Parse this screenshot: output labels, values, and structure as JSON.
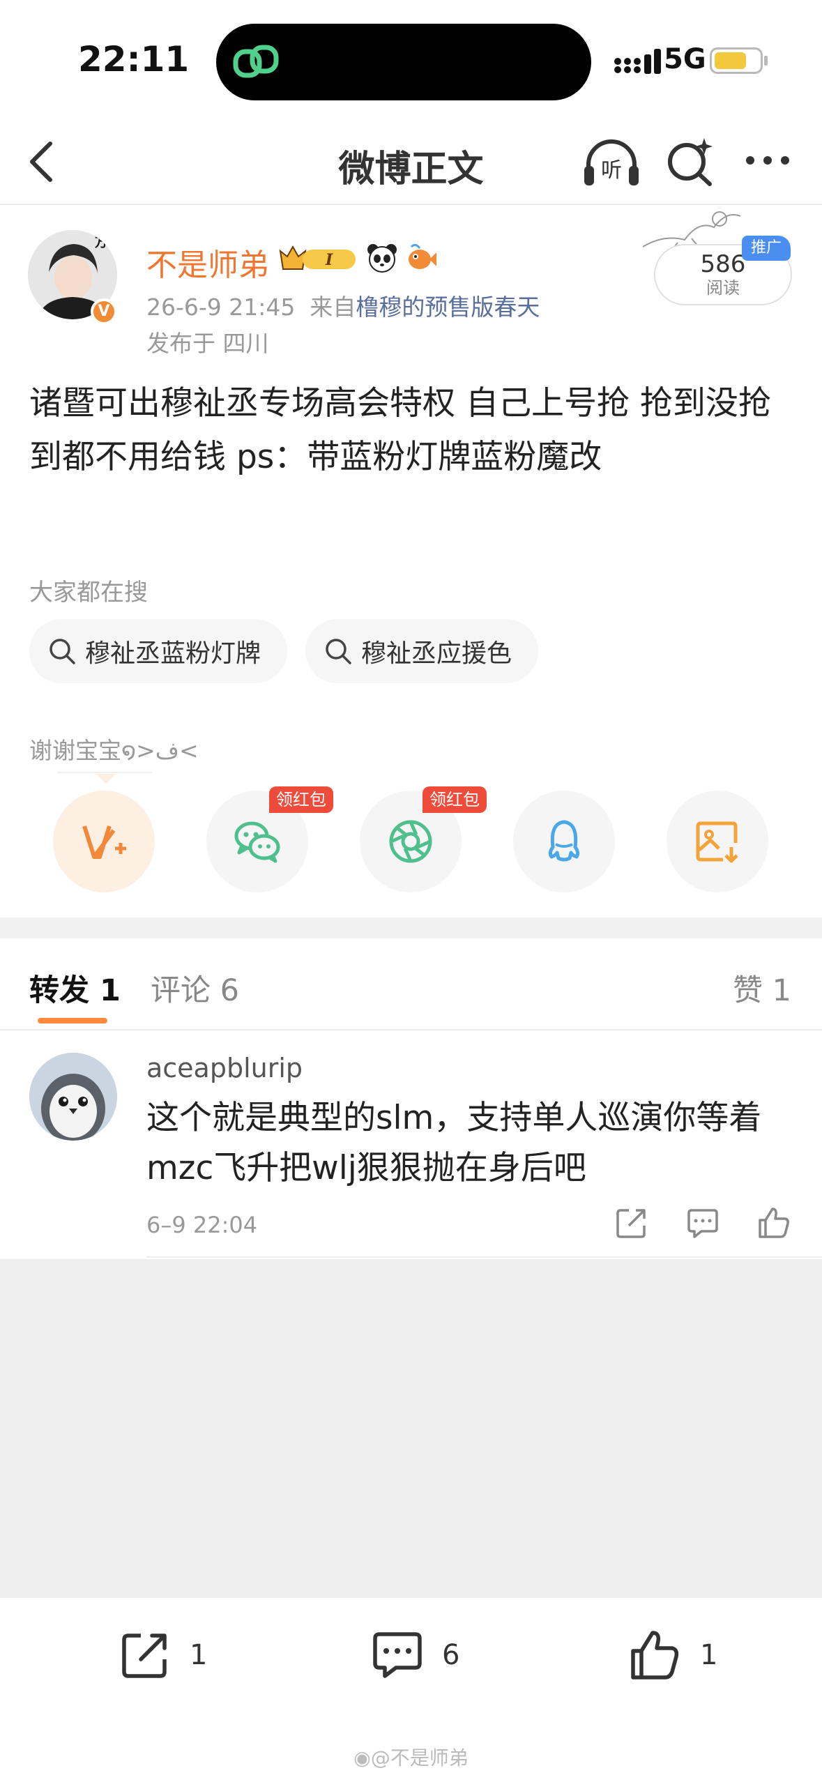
{
  "status": {
    "time": "22:11",
    "network": "5G"
  },
  "nav": {
    "title": "微博正文",
    "listen_label": "听"
  },
  "post": {
    "author": "不是师弟",
    "vip_badge": "I",
    "datetime": "26-6-9 21:45",
    "source_prefix": "来自",
    "source": "橹穆的预售版春天",
    "location": "发布于 四川",
    "text": "诸暨可出穆祉丞专场高会特权  自己上号抢  抢到没抢到都不用给钱  ps：带蓝粉灯牌蓝粉魔改",
    "reads_count": "586",
    "reads_label": "阅读",
    "promo_label": "推广",
    "avatar_caption": "万一"
  },
  "search": {
    "title": "大家都在搜",
    "chips": [
      "穆祉丞蓝粉灯牌",
      "穆祉丞应援色"
    ]
  },
  "thanks": "谢谢宝宝໑>ف<",
  "share": {
    "items": [
      {
        "name": "vip-share",
        "icon": "v-plus-icon"
      },
      {
        "name": "wechat",
        "icon": "wechat-icon",
        "tag": "领红包"
      },
      {
        "name": "moments",
        "icon": "moments-icon",
        "tag": "领红包"
      },
      {
        "name": "qq",
        "icon": "qq-icon"
      },
      {
        "name": "save-image",
        "icon": "save-image-icon"
      }
    ]
  },
  "tabs": {
    "repost": "转发 1",
    "comment": "评论 6",
    "like": "赞 1"
  },
  "comment": {
    "user": "aceapblurip",
    "text": "这个就是典型的slm，支持单人巡演你等着mzc飞升把wlj狠狠抛在身后吧",
    "time": "6–9 22:04"
  },
  "bottom": {
    "repost_count": "1",
    "comment_count": "6",
    "like_count": "1",
    "watermark": "@不是师弟"
  },
  "colors": {
    "accent_orange": "#ef7731",
    "tab_indicator": "#ff8a3c",
    "link_blue": "#5a6e9b",
    "wechat_green": "#4fc08d",
    "qq_blue": "#4aa8e8",
    "red_tag": "#ee4b3a"
  }
}
